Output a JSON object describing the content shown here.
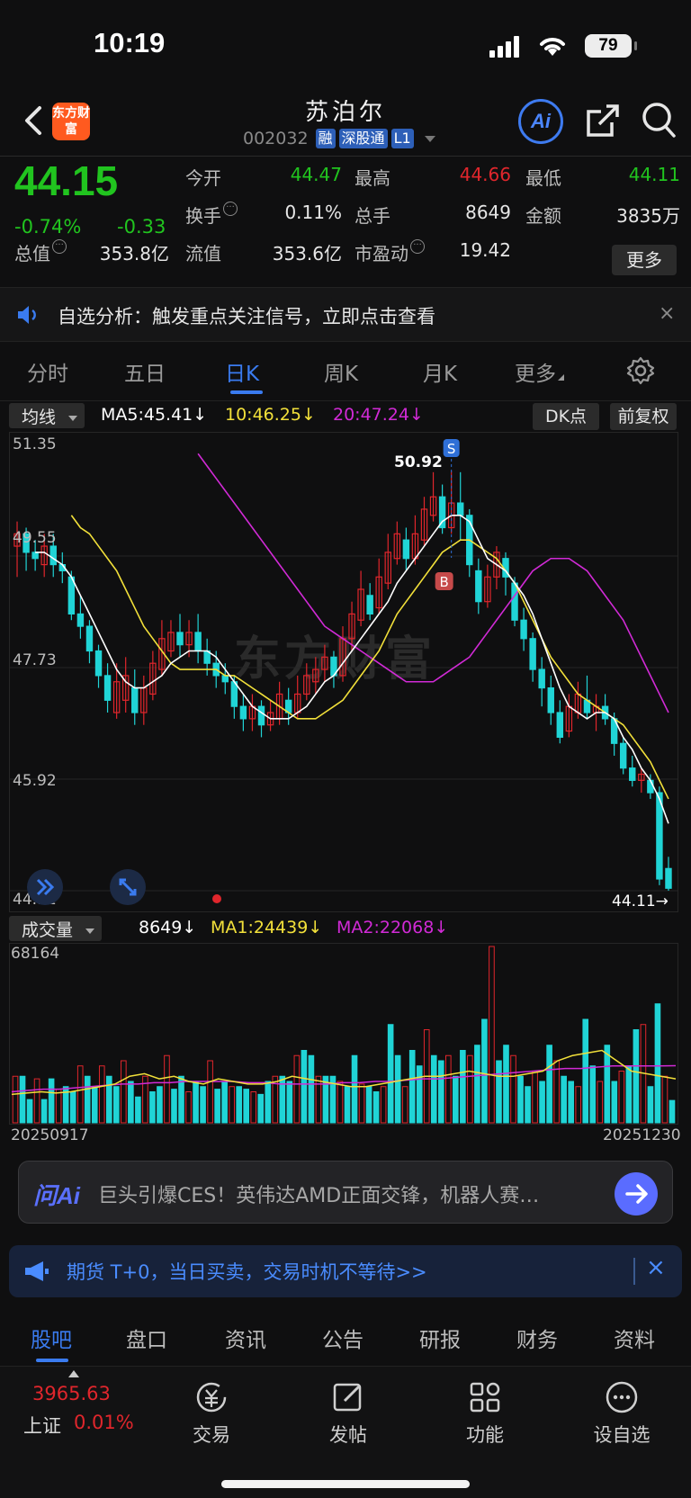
{
  "status_bar": {
    "time": "10:19",
    "battery": "79"
  },
  "header": {
    "logo_text": "东方财富",
    "stock_name": "苏泊尔",
    "stock_code": "002032",
    "tags": [
      "融",
      "深股通",
      "L1"
    ],
    "ai_label": "Ai"
  },
  "quote": {
    "price": "44.15",
    "change_pct": "-0.74%",
    "change": "-0.33",
    "fields": [
      {
        "label": "今开",
        "value": "44.47",
        "color": "#21c41f"
      },
      {
        "label": "最高",
        "value": "44.66",
        "color": "#e0262c"
      },
      {
        "label": "最低",
        "value": "44.11",
        "color": "#21c41f"
      },
      {
        "label": "换手",
        "value": "0.11%",
        "color": "#e6e6e6"
      },
      {
        "label": "总手",
        "value": "8649",
        "color": "#e6e6e6"
      },
      {
        "label": "金额",
        "value": "3835万",
        "color": "#e6e6e6"
      },
      {
        "label": "总值",
        "value": "353.8亿",
        "color": "#e6e6e6"
      },
      {
        "label": "流值",
        "value": "353.6亿",
        "color": "#e6e6e6"
      },
      {
        "label": "市盈动",
        "value": "19.42",
        "color": "#e6e6e6"
      }
    ],
    "more_label": "更多"
  },
  "notice": {
    "text": "自选分析：触发重点关注信号，立即点击查看",
    "close": "×"
  },
  "period_tabs": [
    "分时",
    "五日",
    "日K",
    "周K",
    "月K",
    "更多"
  ],
  "ma_bar": {
    "dropdown": "均线",
    "ma5": "MA5:45.41↓",
    "ma10": "10:46.25↓",
    "ma20": "20:47.24↓",
    "dk_label": "DK点",
    "adjust_label": "前复权"
  },
  "colors": {
    "up": "#e0262c",
    "down": "#20d4d6",
    "ma5": "#ffffff",
    "ma10": "#f2e03a",
    "ma20": "#d12ad6",
    "accent": "#3a7bef"
  },
  "kline": {
    "y_labels": [
      "51.35",
      "49.55",
      "47.73",
      "45.92",
      "44.11"
    ],
    "high_marker": "50.92",
    "low_marker": "44.11",
    "sell_signal": "S",
    "buy_signal": "B",
    "watermark": "东方财富"
  },
  "chart_data": {
    "type": "candlestick",
    "ylim": [
      44.11,
      51.35
    ],
    "candles": [
      {
        "o": 49.7,
        "c": 49.9,
        "h": 50.1,
        "l": 49.2
      },
      {
        "o": 49.9,
        "c": 49.6,
        "h": 50.0,
        "l": 49.3
      },
      {
        "o": 49.6,
        "c": 49.5,
        "h": 49.8,
        "l": 49.3
      },
      {
        "o": 49.4,
        "c": 49.7,
        "h": 49.9,
        "l": 49.2
      },
      {
        "o": 49.7,
        "c": 49.4,
        "h": 49.9,
        "l": 49.2
      },
      {
        "o": 49.4,
        "c": 49.3,
        "h": 49.6,
        "l": 49.1
      },
      {
        "o": 49.2,
        "c": 48.6,
        "h": 49.3,
        "l": 48.5
      },
      {
        "o": 48.6,
        "c": 48.4,
        "h": 48.9,
        "l": 48.2
      },
      {
        "o": 48.4,
        "c": 48.0,
        "h": 48.5,
        "l": 47.8
      },
      {
        "o": 48.0,
        "c": 47.6,
        "h": 48.1,
        "l": 47.4
      },
      {
        "o": 47.6,
        "c": 47.2,
        "h": 47.8,
        "l": 47.0
      },
      {
        "o": 47.0,
        "c": 47.5,
        "h": 47.8,
        "l": 46.9
      },
      {
        "o": 47.2,
        "c": 47.6,
        "h": 47.9,
        "l": 47.0
      },
      {
        "o": 47.4,
        "c": 47.0,
        "h": 47.7,
        "l": 46.8
      },
      {
        "o": 47.0,
        "c": 47.4,
        "h": 47.6,
        "l": 46.8
      },
      {
        "o": 47.3,
        "c": 47.8,
        "h": 48.0,
        "l": 47.2
      },
      {
        "o": 47.7,
        "c": 48.2,
        "h": 48.5,
        "l": 47.6
      },
      {
        "o": 48.0,
        "c": 48.3,
        "h": 48.5,
        "l": 47.9
      },
      {
        "o": 48.3,
        "c": 48.1,
        "h": 48.6,
        "l": 47.9
      },
      {
        "o": 48.1,
        "c": 48.3,
        "h": 48.5,
        "l": 47.9
      },
      {
        "o": 48.3,
        "c": 48.0,
        "h": 48.6,
        "l": 47.8
      },
      {
        "o": 48.0,
        "c": 47.8,
        "h": 48.2,
        "l": 47.6
      },
      {
        "o": 47.8,
        "c": 47.6,
        "h": 48.0,
        "l": 47.4
      },
      {
        "o": 47.6,
        "c": 47.5,
        "h": 47.8,
        "l": 47.3
      },
      {
        "o": 47.5,
        "c": 47.1,
        "h": 47.6,
        "l": 46.9
      },
      {
        "o": 47.1,
        "c": 46.9,
        "h": 47.3,
        "l": 46.7
      },
      {
        "o": 46.9,
        "c": 47.1,
        "h": 47.3,
        "l": 46.7
      },
      {
        "o": 47.1,
        "c": 46.8,
        "h": 47.2,
        "l": 46.6
      },
      {
        "o": 46.8,
        "c": 47.0,
        "h": 47.2,
        "l": 46.7
      },
      {
        "o": 46.9,
        "c": 47.3,
        "h": 47.5,
        "l": 46.8
      },
      {
        "o": 47.2,
        "c": 47.0,
        "h": 47.4,
        "l": 46.8
      },
      {
        "o": 47.0,
        "c": 47.3,
        "h": 47.6,
        "l": 46.9
      },
      {
        "o": 47.3,
        "c": 47.6,
        "h": 47.8,
        "l": 47.2
      },
      {
        "o": 47.5,
        "c": 47.7,
        "h": 47.9,
        "l": 47.3
      },
      {
        "o": 47.7,
        "c": 47.9,
        "h": 48.1,
        "l": 47.5
      },
      {
        "o": 47.9,
        "c": 47.6,
        "h": 48.0,
        "l": 47.4
      },
      {
        "o": 47.6,
        "c": 48.2,
        "h": 48.4,
        "l": 47.5
      },
      {
        "o": 48.2,
        "c": 48.6,
        "h": 48.8,
        "l": 48.0
      },
      {
        "o": 48.5,
        "c": 49.0,
        "h": 49.3,
        "l": 48.4
      },
      {
        "o": 48.9,
        "c": 48.6,
        "h": 49.1,
        "l": 48.5
      },
      {
        "o": 48.7,
        "c": 49.2,
        "h": 49.5,
        "l": 48.6
      },
      {
        "o": 49.1,
        "c": 49.6,
        "h": 49.9,
        "l": 49.0
      },
      {
        "o": 49.5,
        "c": 49.9,
        "h": 50.1,
        "l": 49.4
      },
      {
        "o": 49.8,
        "c": 49.5,
        "h": 50.0,
        "l": 49.3
      },
      {
        "o": 49.5,
        "c": 49.9,
        "h": 50.2,
        "l": 49.4
      },
      {
        "o": 49.8,
        "c": 50.3,
        "h": 50.5,
        "l": 49.7
      },
      {
        "o": 50.2,
        "c": 50.5,
        "h": 50.9,
        "l": 50.1
      },
      {
        "o": 50.5,
        "c": 50.0,
        "h": 50.7,
        "l": 49.9
      },
      {
        "o": 50.0,
        "c": 50.4,
        "h": 50.92,
        "l": 49.9
      },
      {
        "o": 50.4,
        "c": 50.2,
        "h": 50.9,
        "l": 49.8
      },
      {
        "o": 50.2,
        "c": 49.4,
        "h": 50.3,
        "l": 49.2
      },
      {
        "o": 49.3,
        "c": 48.8,
        "h": 49.5,
        "l": 48.6
      },
      {
        "o": 48.8,
        "c": 49.2,
        "h": 49.4,
        "l": 48.7
      },
      {
        "o": 49.2,
        "c": 49.6,
        "h": 49.7,
        "l": 49.0
      },
      {
        "o": 49.5,
        "c": 49.2,
        "h": 49.6,
        "l": 48.9
      },
      {
        "o": 49.1,
        "c": 48.5,
        "h": 49.2,
        "l": 48.4
      },
      {
        "o": 48.5,
        "c": 48.2,
        "h": 48.7,
        "l": 48.0
      },
      {
        "o": 48.2,
        "c": 47.7,
        "h": 48.3,
        "l": 47.5
      },
      {
        "o": 47.7,
        "c": 47.4,
        "h": 47.9,
        "l": 47.1
      },
      {
        "o": 47.4,
        "c": 47.0,
        "h": 47.6,
        "l": 46.8
      },
      {
        "o": 47.0,
        "c": 46.6,
        "h": 47.2,
        "l": 46.5
      },
      {
        "o": 46.7,
        "c": 47.1,
        "h": 47.3,
        "l": 46.6
      },
      {
        "o": 47.0,
        "c": 47.3,
        "h": 47.5,
        "l": 46.9
      },
      {
        "o": 47.2,
        "c": 47.0,
        "h": 47.6,
        "l": 46.9
      },
      {
        "o": 47.0,
        "c": 47.1,
        "h": 47.3,
        "l": 46.7
      },
      {
        "o": 47.1,
        "c": 46.9,
        "h": 47.3,
        "l": 46.8
      },
      {
        "o": 46.9,
        "c": 46.5,
        "h": 47.0,
        "l": 46.3
      },
      {
        "o": 46.5,
        "c": 46.1,
        "h": 46.6,
        "l": 46.0
      },
      {
        "o": 46.1,
        "c": 45.9,
        "h": 46.3,
        "l": 45.8
      },
      {
        "o": 45.9,
        "c": 46.0,
        "h": 46.1,
        "l": 45.7
      },
      {
        "o": 45.9,
        "c": 45.7,
        "h": 46.0,
        "l": 45.6
      },
      {
        "o": 45.7,
        "c": 44.3,
        "h": 45.8,
        "l": 44.2
      },
      {
        "o": 44.47,
        "c": 44.15,
        "h": 44.66,
        "l": 44.11
      }
    ],
    "ma5": [
      49.6,
      49.6,
      49.5,
      49.4,
      49.2,
      48.9,
      48.6,
      48.3,
      48.0,
      47.7,
      47.5,
      47.4,
      47.4,
      47.5,
      47.6,
      47.8,
      47.9,
      48.0,
      48.0,
      48.0,
      47.9,
      47.7,
      47.5,
      47.3,
      47.1,
      47.0,
      46.9,
      46.9,
      46.9,
      47.0,
      47.1,
      47.3,
      47.5,
      47.6,
      47.8,
      48.0,
      48.2,
      48.4,
      48.6,
      48.8,
      49.1,
      49.3,
      49.5,
      49.7,
      49.9,
      50.1,
      50.2,
      50.2,
      50.1,
      49.8,
      49.5,
      49.4,
      49.3,
      49.1,
      48.9,
      48.6,
      48.2,
      47.8,
      47.4,
      47.1,
      47.0,
      46.9,
      47.0,
      47.0,
      46.9,
      46.6,
      46.4,
      46.1,
      45.9,
      45.6,
      45.2
    ],
    "ma10": [
      50.2,
      50.0,
      49.9,
      49.7,
      49.5,
      49.3,
      49.0,
      48.7,
      48.4,
      48.2,
      48.0,
      47.8,
      47.7,
      47.7,
      47.7,
      47.7,
      47.7,
      47.6,
      47.6,
      47.5,
      47.4,
      47.3,
      47.2,
      47.1,
      47.0,
      46.9,
      46.9,
      46.9,
      47.0,
      47.1,
      47.2,
      47.4,
      47.6,
      47.8,
      48.0,
      48.3,
      48.6,
      48.8,
      49.0,
      49.2,
      49.4,
      49.6,
      49.7,
      49.8,
      49.8,
      49.7,
      49.6,
      49.5,
      49.3,
      49.1,
      48.8,
      48.5,
      48.2,
      47.9,
      47.7,
      47.5,
      47.3,
      47.2,
      47.1,
      47.0,
      46.9,
      46.8,
      46.6,
      46.4,
      46.2,
      45.9,
      45.6
    ],
    "ma20": [
      51.2,
      51.0,
      50.8,
      50.6,
      50.4,
      50.2,
      50.0,
      49.8,
      49.6,
      49.4,
      49.2,
      49.0,
      48.8,
      48.6,
      48.4,
      48.3,
      48.2,
      48.1,
      48.0,
      47.9,
      47.8,
      47.7,
      47.6,
      47.5,
      47.5,
      47.5,
      47.5,
      47.6,
      47.7,
      47.8,
      47.9,
      48.1,
      48.3,
      48.5,
      48.7,
      48.9,
      49.1,
      49.3,
      49.4,
      49.5,
      49.5,
      49.5,
      49.4,
      49.3,
      49.1,
      48.9,
      48.7,
      48.5,
      48.2,
      47.9,
      47.6,
      47.3,
      47.0
    ],
    "volume": {
      "max_label": "68164",
      "start_date": "20250917",
      "end_date": "20251230",
      "values": [
        18000,
        18000,
        9000,
        17000,
        9000,
        17000,
        13000,
        14000,
        12000,
        22000,
        18000,
        14000,
        22000,
        18000,
        14000,
        24000,
        16000,
        10000,
        18000,
        12000,
        14000,
        26000,
        13000,
        18000,
        12000,
        16000,
        14000,
        24000,
        13000,
        16000,
        14000,
        14000,
        13000,
        12000,
        11000,
        16000,
        18000,
        18000,
        16000,
        26000,
        28000,
        26000,
        18000,
        18000,
        18000,
        16000,
        14000,
        26000,
        15000,
        14000,
        12000,
        14000,
        38000,
        26000,
        14000,
        28000,
        22000,
        36000,
        26000,
        24000,
        26000,
        18000,
        28000,
        26000,
        30000,
        40000,
        68164,
        24000,
        30000,
        26000,
        18000,
        14000,
        20000,
        16000,
        30000,
        24000,
        18000,
        16000,
        14000,
        40000,
        22000,
        16000,
        30000,
        16000,
        20000,
        22000,
        36000,
        38000,
        14000,
        46000,
        18000,
        8649
      ]
    },
    "ma1_line": [
      11000,
      11500,
      12000,
      11500,
      12000,
      13000,
      14000,
      15000,
      18000,
      19000,
      17000,
      18000,
      16000,
      15000,
      17000,
      16000,
      15000,
      15000,
      16000,
      18000,
      17000,
      16000,
      15000,
      14000,
      14000,
      15000,
      16000,
      17000,
      18000,
      18000,
      19000,
      20000,
      19000,
      18000,
      18000,
      19000,
      20000,
      24000,
      26000,
      27000,
      28000,
      24000,
      20000,
      19000,
      18000,
      17000
    ],
    "ma2_line": [
      12000,
      12500,
      13000,
      13000,
      13500,
      14000,
      14500,
      15000,
      15000,
      15500,
      15500,
      16000,
      16000,
      16000,
      16000,
      15500,
      15500,
      15000,
      15000,
      15000,
      15000,
      15500,
      15500,
      16000,
      16000,
      16500,
      17000,
      17000,
      17500,
      18000,
      18500,
      19000,
      19500,
      20000,
      20500,
      21000,
      21000,
      21500,
      22000,
      22000,
      22000,
      22000,
      22068
    ],
    "type_detail": "daily candlestick with MA5/MA10/MA20 and volume panel"
  },
  "vol_bar": {
    "dropdown": "成交量",
    "vol": "8649↓",
    "ma1": "MA1:24439↓",
    "ma2": "MA2:22068↓"
  },
  "askai": {
    "logo": "问Ai",
    "text": "巨头引爆CES！英伟达AMD正面交锋，机器人赛…"
  },
  "promo": {
    "text": "期货 T+0，当日买卖，交易时机不等待>>"
  },
  "bottom_tabs": [
    "股吧",
    "盘口",
    "资讯",
    "公告",
    "研报",
    "财务",
    "资料"
  ],
  "dock": {
    "index_value": "3965.63",
    "index_name": "上证",
    "index_pct": "0.01%",
    "items": [
      "交易",
      "发帖",
      "功能",
      "设自选"
    ]
  }
}
